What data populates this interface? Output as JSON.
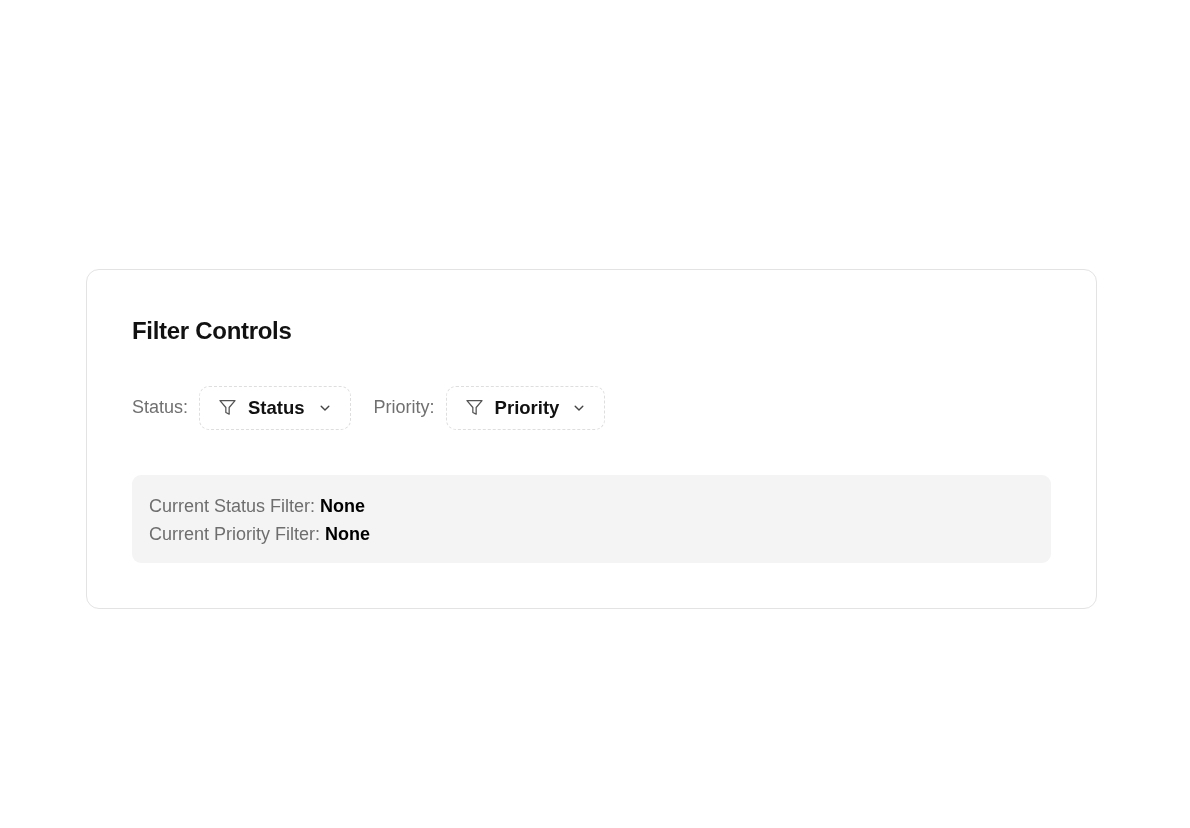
{
  "card": {
    "title": "Filter Controls"
  },
  "filters": [
    {
      "label": "Status:",
      "button": "Status"
    },
    {
      "label": "Priority:",
      "button": "Priority"
    }
  ],
  "summary": [
    {
      "label": "Current Status Filter:",
      "value": "None"
    },
    {
      "label": "Current Priority Filter:",
      "value": "None"
    }
  ]
}
